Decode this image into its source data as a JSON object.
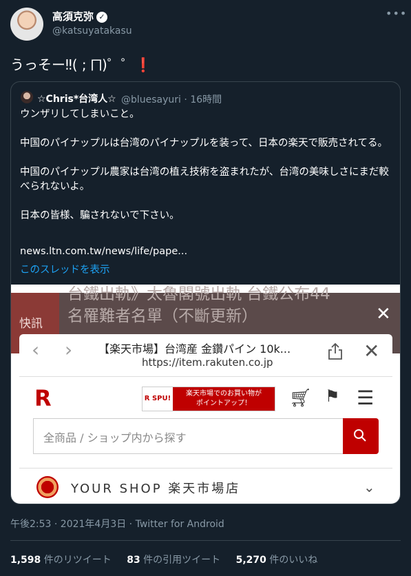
{
  "author": {
    "name": "高須克弥",
    "handle": "@katsuyatakasu"
  },
  "tweet": {
    "text": "うっそー‼( ; ⨅)゜゜",
    "emoji": "❗"
  },
  "quote": {
    "name": "☆Chris*台湾人☆",
    "handle": "@bluesayuri",
    "time": "16時間",
    "lines": [
      "ウンザリしてしまいこと。",
      "中国のパイナップルは台湾のパイナップルを装って、日本の楽天で販売されてる。",
      "中国のパイナップル農家は台湾の植え技術を盗まれたが、台湾の美味しさにまだ較べられないよ。",
      "日本の皆様、騙されないで下さい。"
    ],
    "link": "news.ltn.com.tw/news/life/pape...",
    "show_thread": "このスレッドを表示"
  },
  "screenshot": {
    "news_label": "快訊",
    "news_line1": "台鐵出軌》太魯閣號出軌 台鐵公布44",
    "news_line2": "名罹難者名單（不斷更新）",
    "page_title": "【楽天市場】台湾産 金鑽パイン 10k...",
    "page_url": "https://item.rakuten.co.jp",
    "logo": "R",
    "spu_left": "R SPU!",
    "spu_right_1": "楽天市場でのお買い物が",
    "spu_right_2": "ポイントアップ！",
    "search_placeholder": "全商品 / ショップ内から探す",
    "shop_name": "YOUR  SHOP  楽天市場店"
  },
  "meta": {
    "timestamp": "午後2:53 · 2021年4月3日 · Twitter for Android"
  },
  "stats": {
    "retweets_count": "1,598",
    "retweets_label": "件のリツイート",
    "quotes_count": "83",
    "quotes_label": "件の引用ツイート",
    "likes_count": "5,270",
    "likes_label": "件のいいね"
  }
}
